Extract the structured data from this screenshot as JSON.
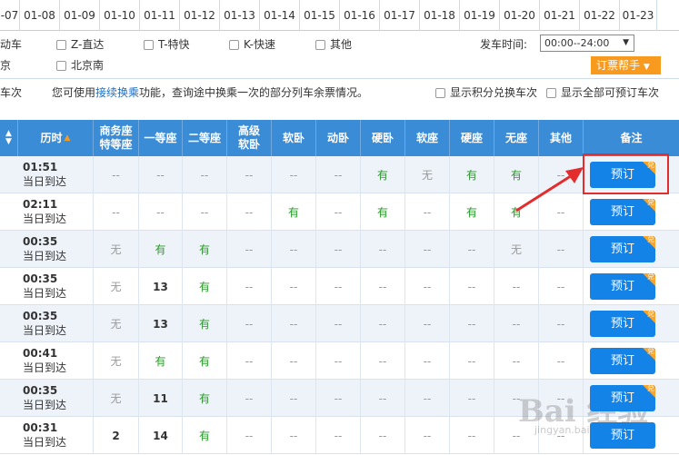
{
  "date_tabs": [
    "-07",
    "01-08",
    "01-09",
    "01-10",
    "01-11",
    "01-12",
    "01-13",
    "01-14",
    "01-15",
    "01-16",
    "01-17",
    "01-18",
    "01-19",
    "01-20",
    "01-21",
    "01-22",
    "01-23"
  ],
  "filters": {
    "row1": [
      "动车",
      "Z-直达",
      "T-特快",
      "K-快速",
      "其他"
    ],
    "row2": [
      "京",
      "北京南"
    ],
    "depart_label": "发车时间:",
    "depart_value": "00:00--24:00",
    "help_button": "订票帮手"
  },
  "info": {
    "left_text": "车次",
    "prefix": "您可使用",
    "link": "接续换乘",
    "suffix": "功能，查询途中换乘一次的部分列车余票情况。",
    "opt1": "显示积分兑换车次",
    "opt2": "显示全部可预订车次"
  },
  "headers": {
    "duration": "历时",
    "business": "商务座特等座",
    "first": "一等座",
    "second": "二等座",
    "senior_soft_sleeper": "高级软卧",
    "soft_sleeper": "软卧",
    "moving_sleeper": "动卧",
    "hard_sleeper": "硬卧",
    "soft_seat": "软座",
    "hard_seat": "硬座",
    "no_seat": "无座",
    "other": "其他",
    "note": "备注"
  },
  "rows": [
    {
      "time": "01:51",
      "day": "当日到达",
      "cells": [
        "--",
        "--",
        "--",
        "--",
        "--",
        "--",
        "有",
        "无",
        "有",
        "有",
        "--"
      ],
      "book": "预订",
      "badge": "兑"
    },
    {
      "time": "02:11",
      "day": "当日到达",
      "cells": [
        "--",
        "--",
        "--",
        "--",
        "有",
        "--",
        "有",
        "--",
        "有",
        "有",
        "--"
      ],
      "book": "预订",
      "badge": "兑"
    },
    {
      "time": "00:35",
      "day": "当日到达",
      "cells": [
        "无",
        "有",
        "有",
        "--",
        "--",
        "--",
        "--",
        "--",
        "--",
        "无",
        "--"
      ],
      "book": "预订",
      "badge": "兑"
    },
    {
      "time": "00:35",
      "day": "当日到达",
      "cells": [
        "无",
        "13",
        "有",
        "--",
        "--",
        "--",
        "--",
        "--",
        "--",
        "--",
        "--"
      ],
      "book": "预订",
      "badge": "兑"
    },
    {
      "time": "00:35",
      "day": "当日到达",
      "cells": [
        "无",
        "13",
        "有",
        "--",
        "--",
        "--",
        "--",
        "--",
        "--",
        "--",
        "--"
      ],
      "book": "预订",
      "badge": "兑"
    },
    {
      "time": "00:41",
      "day": "当日到达",
      "cells": [
        "无",
        "有",
        "有",
        "--",
        "--",
        "--",
        "--",
        "--",
        "--",
        "--",
        "--"
      ],
      "book": "预订",
      "badge": "兑"
    },
    {
      "time": "00:35",
      "day": "当日到达",
      "cells": [
        "无",
        "11",
        "有",
        "--",
        "--",
        "--",
        "--",
        "--",
        "--",
        "--",
        "--"
      ],
      "book": "预订",
      "badge": "兑"
    },
    {
      "time": "00:31",
      "day": "当日到达",
      "cells": [
        "2",
        "14",
        "有",
        "--",
        "--",
        "--",
        "--",
        "--",
        "--",
        "--",
        "--"
      ],
      "book": "预订",
      "badge": ""
    }
  ],
  "watermark": {
    "main": "Bai 经验",
    "sub": "jingyan.baidu.com"
  }
}
